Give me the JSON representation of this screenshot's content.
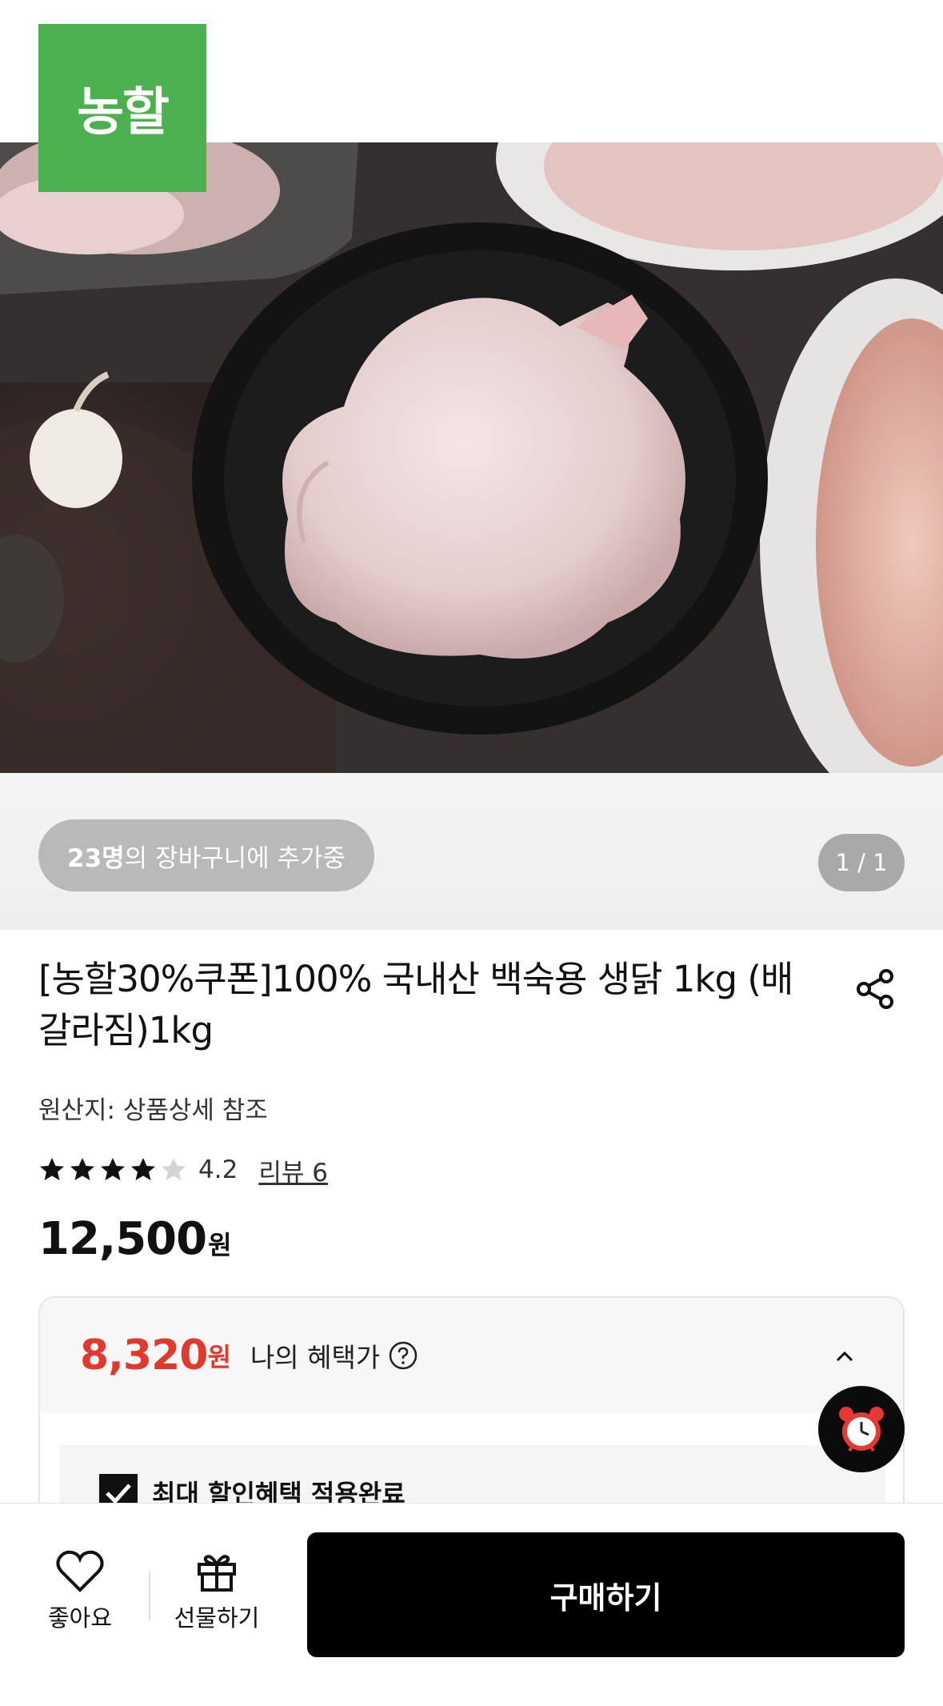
{
  "brand": {
    "logo_text": "농할",
    "color": "#4caf50"
  },
  "hero": {
    "image_alt": "whole raw chicken in black pot"
  },
  "info_strip": {
    "cart_count": "23명",
    "cart_text": "의 장바구니에 추가중",
    "page_counter": "1 / 1"
  },
  "product": {
    "title": "[농할30%쿠폰]100% 국내산 백숙용 생닭 1kg (배갈라짐)1kg",
    "origin": "원산지: 상품상세 참조",
    "rating": 4.2,
    "rating_text": "4.2",
    "review_link": "리뷰 6",
    "price": "12,500",
    "price_unit": "원"
  },
  "benefit": {
    "price": "8,320",
    "unit": "원",
    "label": "나의 혜택가",
    "checkbox_label": "최대 할인혜택 적용완료",
    "accent_color": "#e03a2f"
  },
  "bottom_bar": {
    "like_label": "좋아요",
    "gift_label": "선물하기",
    "buy_label": "구매하기"
  },
  "icons": {
    "share": "share-icon",
    "like": "heart-icon",
    "gift": "gift-icon",
    "help": "question-circle-icon",
    "collapse": "chevron-up-icon",
    "alarm": "alarm-clock-icon",
    "star": "star-icon"
  }
}
